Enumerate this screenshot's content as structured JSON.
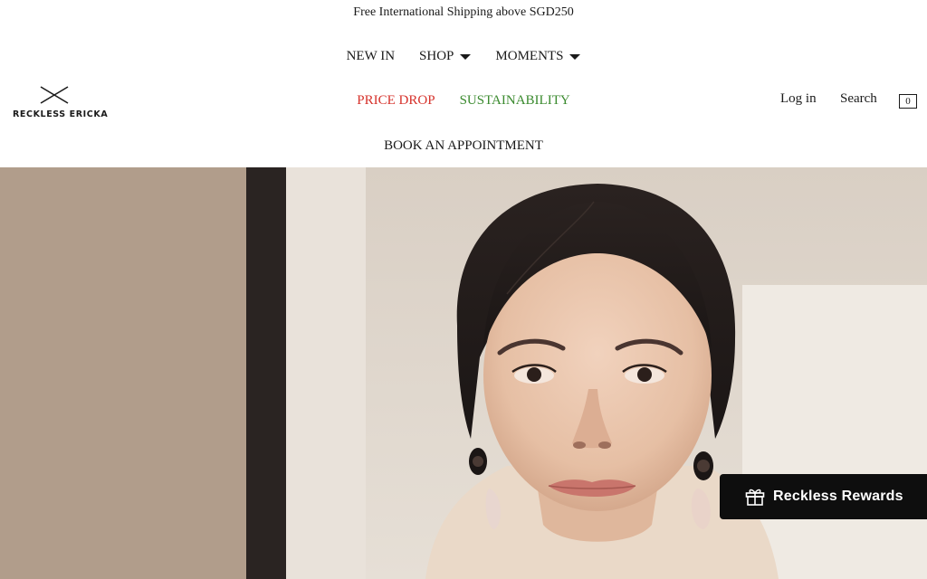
{
  "announcement": {
    "text": "Free International Shipping above SGD250"
  },
  "brand": {
    "name": "RECKLESS ERICKA",
    "logo_icon": "crossed-lines-logo"
  },
  "nav": {
    "new_in": "NEW IN",
    "shop": "SHOP",
    "moments": "MOMENTS",
    "price_drop": "PRICE DROP",
    "sustainability": "SUSTAINABILITY",
    "book_appointment": "BOOK AN APPOINTMENT",
    "dropdown_icon": "caret-down-icon"
  },
  "colors": {
    "price_drop": "#d6322b",
    "sustainability": "#3a8a2e",
    "text": "#1a1a1a",
    "rewards_bg": "#0e0e0e"
  },
  "utility": {
    "login": "Log in",
    "search": "Search",
    "cart_count": "0"
  },
  "rewards": {
    "label": "Reckless Rewards",
    "icon": "gift-icon"
  }
}
